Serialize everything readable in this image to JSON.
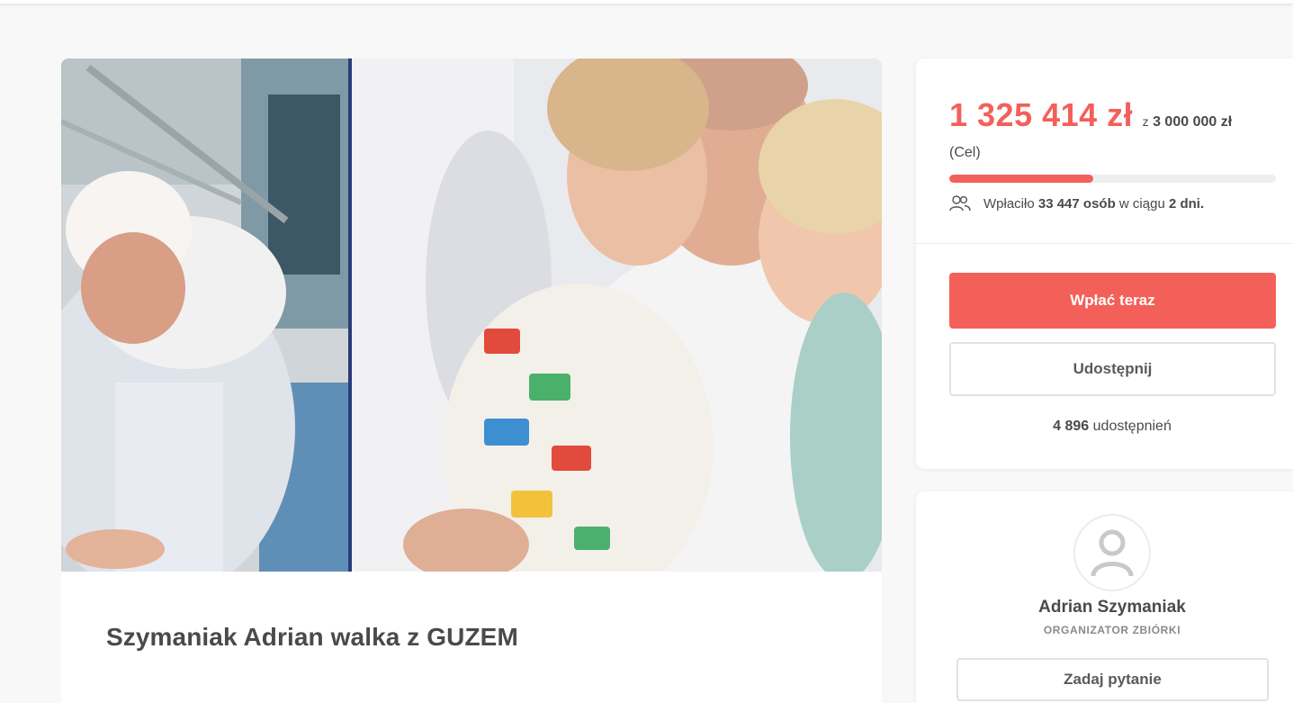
{
  "campaign": {
    "title": "Szymaniak Adrian walka z GUZEM",
    "photo_icon": "campaign-photo"
  },
  "donation": {
    "amount_raised": "1 325 414 zł",
    "goal_prefix": "z",
    "goal_amount": "3 000 000 zł",
    "goal_label": "(Cel)",
    "progress_fraction": 0.4418,
    "donors_prefix": "Wpłaciło",
    "donors_count": "33 447 osób",
    "donors_mid": "w ciągu",
    "donors_days": "2 dni.",
    "donors_icon": "people-icon",
    "pay_button": "Wpłać teraz",
    "share_button": "Udostępnij",
    "shares_count": "4 896",
    "shares_label": "udostępnień"
  },
  "organizer": {
    "avatar_icon": "user-icon",
    "name": "Adrian Szymaniak",
    "role": "ORGANIZATOR ZBIÓRKI",
    "ask_button": "Zadaj pytanie"
  },
  "colors": {
    "accent": "#f3605a",
    "progress_track": "#eeeeee"
  }
}
